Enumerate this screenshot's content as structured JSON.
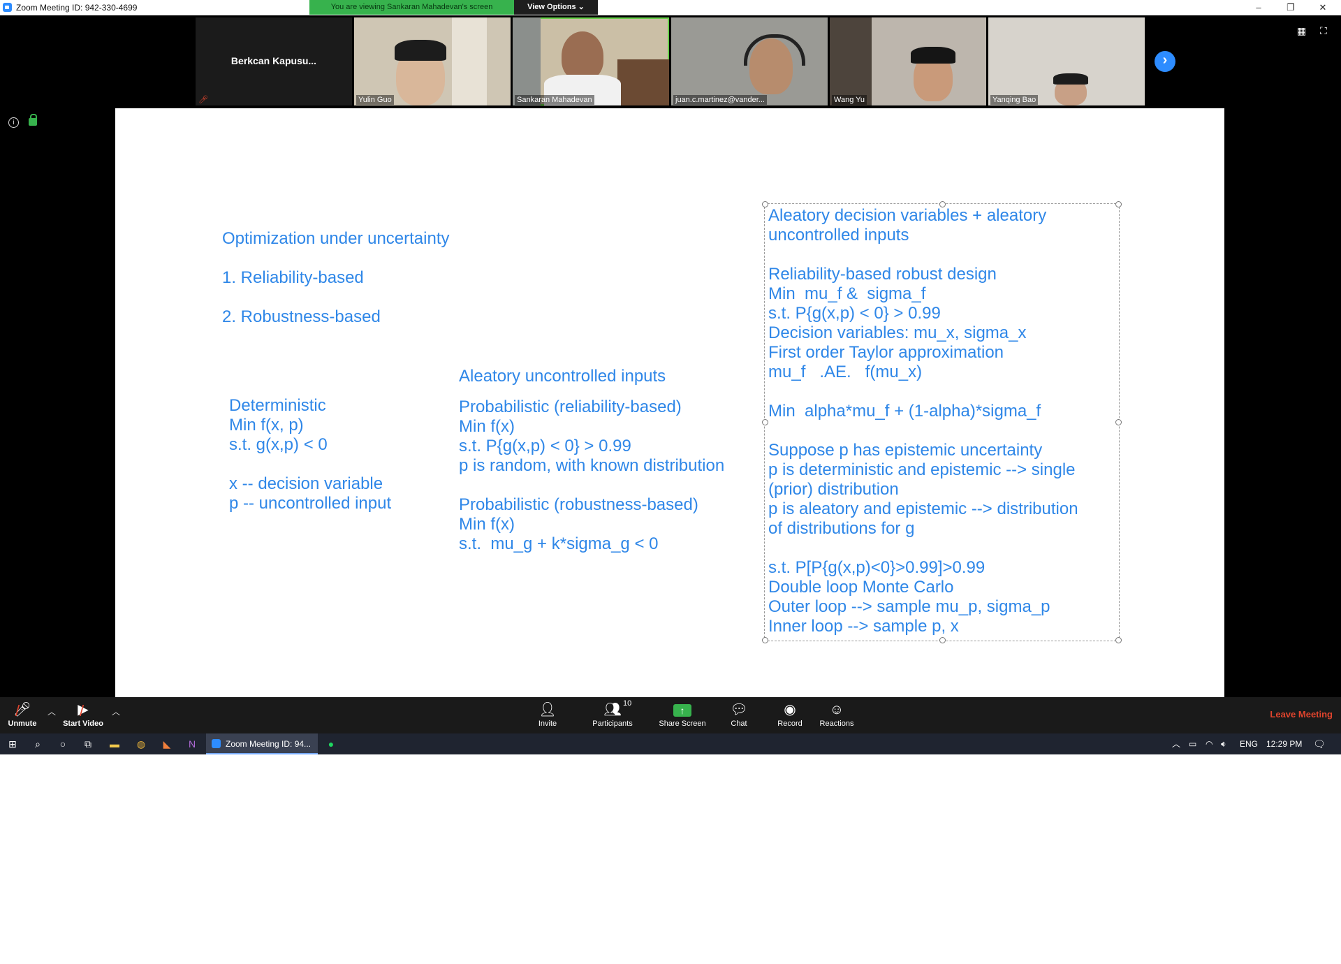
{
  "window": {
    "title": "Zoom Meeting ID: 942-330-4699",
    "viewing_banner": "You are viewing Sankaran Mahadevan's screen",
    "view_options": "View Options",
    "minimize": "–",
    "restore": "❐",
    "close": "✕"
  },
  "participants_strip": {
    "tiles": [
      {
        "label": "Berkcan  Kapusu..."
      },
      {
        "label": "Yulin Guo"
      },
      {
        "label": "Sankaran Mahadevan"
      },
      {
        "label": "juan.c.martinez@vander..."
      },
      {
        "label": "Wang Yu"
      },
      {
        "label": "Yanqing Bao"
      }
    ],
    "next_arrow": "›"
  },
  "slide": {
    "heading": "Optimization under uncertainty",
    "item1": "1. Reliability-based",
    "item2": "2. Robustness-based",
    "col1": "Deterministic\nMin f(x, p)\ns.t. g(x,p) < 0\n\nx -- decision variable\np -- uncontrolled input",
    "col2_header": "Aleatory uncontrolled inputs",
    "col2": "Probabilistic (reliability-based)\nMin f(x)\ns.t. P{g(x,p) < 0} > 0.99\np is random, with known distribution\n\nProbabilistic (robustness-based)\nMin f(x)\ns.t.  mu_g + k*sigma_g < 0",
    "col3": "Aleatory decision variables + aleatory\nuncontrolled inputs\n\nReliability-based robust design\nMin  mu_f &  sigma_f\ns.t. P{g(x,p) < 0} > 0.99\nDecision variables: mu_x, sigma_x\nFirst order Taylor approximation\nmu_f   .AE.   f(mu_x)\n\nMin  alpha*mu_f + (1-alpha)*sigma_f\n\nSuppose p has epistemic uncertainty\np is deterministic and epistemic --> single\n(prior) distribution\np is aleatory and epistemic --> distribution\nof distributions for g\n\ns.t. P[P{g(x,p)<0}>0.99]>0.99\nDouble loop Monte Carlo\nOuter loop --> sample mu_p, sigma_p\nInner loop --> sample p, x"
  },
  "controls": {
    "unmute": "Unmute",
    "start_video": "Start Video",
    "invite": "Invite",
    "participants": "Participants",
    "participants_count": "10",
    "share_screen": "Share Screen",
    "chat": "Chat",
    "record": "Record",
    "reactions": "Reactions",
    "leave": "Leave Meeting"
  },
  "taskbar": {
    "zoom_task": "Zoom Meeting ID: 94...",
    "lang": "ENG",
    "time": "12:29 PM"
  },
  "colors": {
    "slide_text": "#2f87e8",
    "banner_green": "#37b24d",
    "zoom_blue": "#2d8cff",
    "leave_red": "#e0442d"
  }
}
